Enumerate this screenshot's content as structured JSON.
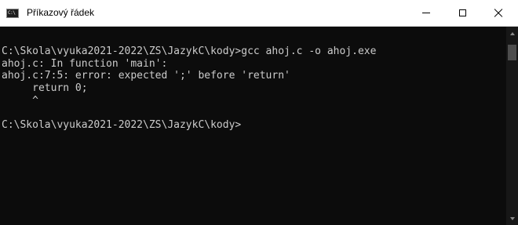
{
  "window": {
    "title": "Příkazový řádek",
    "app_icon_text": "C:\\",
    "controls": {
      "minimize": "minimize-icon",
      "maximize": "maximize-icon",
      "close": "close-icon"
    }
  },
  "console": {
    "lines": [
      "C:\\Skola\\vyuka2021-2022\\ZS\\JazykC\\kody>gcc ahoj.c -o ahoj.exe",
      "ahoj.c: In function 'main':",
      "ahoj.c:7:5: error: expected ';' before 'return'",
      "     return 0;",
      "     ^",
      "",
      "C:\\Skola\\vyuka2021-2022\\ZS\\JazykC\\kody>"
    ]
  },
  "colors": {
    "console_bg": "#0c0c0c",
    "console_fg": "#cccccc",
    "titlebar_bg": "#ffffff"
  }
}
